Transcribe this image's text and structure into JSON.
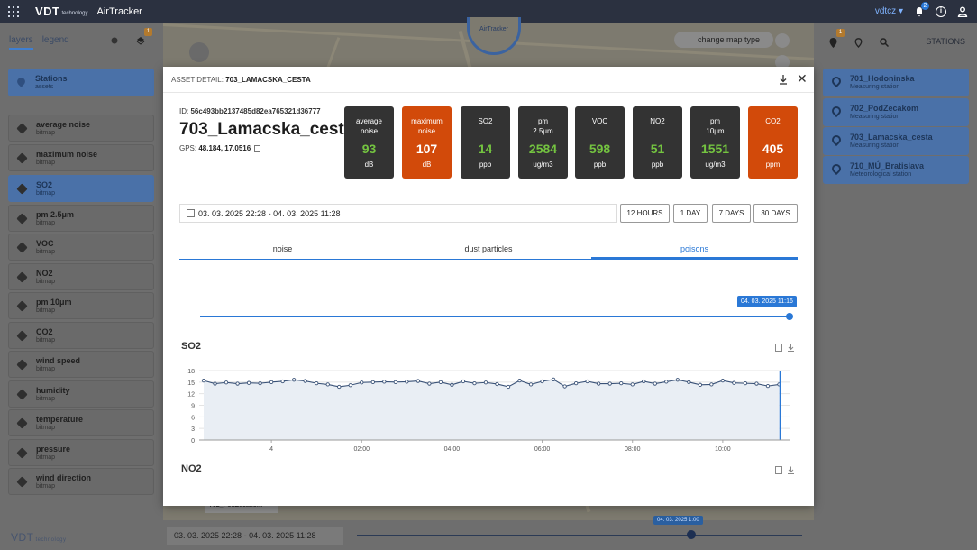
{
  "app": {
    "logo": "VDT",
    "logo_sub": "technology",
    "name": "AirTracker",
    "user": "vdtcz",
    "notifications": "2",
    "info": "i"
  },
  "map": {
    "center_badge": "AirTracker",
    "change_map_type": "change map type",
    "label": "702_PodZecakom"
  },
  "left_panel": {
    "tabs": [
      "layers",
      "legend"
    ],
    "badge": "1",
    "stations": {
      "title": "Stations",
      "subtitle": "assets"
    },
    "layers": [
      {
        "title": "average noise",
        "subtitle": "bitmap"
      },
      {
        "title": "maximum noise",
        "subtitle": "bitmap"
      },
      {
        "title": "SO2",
        "subtitle": "bitmap"
      },
      {
        "title": "pm 2.5μm",
        "subtitle": "bitmap"
      },
      {
        "title": "VOC",
        "subtitle": "bitmap"
      },
      {
        "title": "NO2",
        "subtitle": "bitmap"
      },
      {
        "title": "pm 10μm",
        "subtitle": "bitmap"
      },
      {
        "title": "CO2",
        "subtitle": "bitmap"
      },
      {
        "title": "wind speed",
        "subtitle": "bitmap"
      },
      {
        "title": "humidity",
        "subtitle": "bitmap"
      },
      {
        "title": "temperature",
        "subtitle": "bitmap"
      },
      {
        "title": "pressure",
        "subtitle": "bitmap"
      },
      {
        "title": "wind direction",
        "subtitle": "bitmap"
      }
    ],
    "selected_layer": "SO2"
  },
  "right_panel": {
    "title": "STATIONS",
    "badge": "1",
    "stations": [
      {
        "title": "701_Hodoninska",
        "subtitle": "Measuring station"
      },
      {
        "title": "702_PodZecakom",
        "subtitle": "Measuring station"
      },
      {
        "title": "703_Lamacska_cesta",
        "subtitle": "Measuring station"
      },
      {
        "title": "710_MÚ_Bratislava",
        "subtitle": "Meteorological station"
      }
    ]
  },
  "bottom_bar": {
    "range": "03. 03. 2025 22:28 - 04. 03. 2025 11:28",
    "tip": "04. 03. 2025 1:00"
  },
  "modal": {
    "caption_label": "ASSET DETAIL:",
    "caption_value": "703_LAMACSKA_CESTA",
    "id_label": "ID:",
    "id_value": "56c493bb2137485d82ea765321d36777",
    "name": "703_Lamacska_cesta",
    "gps_label": "GPS:",
    "gps_value": "48.184, 17.0516",
    "tiles": [
      {
        "label": "average noise",
        "value": "93",
        "unit": "dB",
        "status": "normal"
      },
      {
        "label": "maximum noise",
        "value": "107",
        "unit": "dB",
        "status": "warning"
      },
      {
        "label": "SO2",
        "value": "14",
        "unit": "ppb",
        "status": "normal"
      },
      {
        "label": "pm 2.5μm",
        "value": "2584",
        "unit": "ug/m3",
        "status": "normal"
      },
      {
        "label": "VOC",
        "value": "598",
        "unit": "ppb",
        "status": "normal"
      },
      {
        "label": "NO2",
        "value": "51",
        "unit": "ppb",
        "status": "normal"
      },
      {
        "label": "pm 10μm",
        "value": "1551",
        "unit": "ug/m3",
        "status": "normal"
      },
      {
        "label": "CO2",
        "value": "405",
        "unit": "ppm",
        "status": "warning"
      }
    ],
    "date_range": "03. 03. 2025 22:28 - 04. 03. 2025 11:28",
    "range_buttons": [
      "12 HOURS",
      "1 DAY",
      "7 DAYS",
      "30 DAYS"
    ],
    "tabs": [
      "noise",
      "dust particles",
      "poisons"
    ],
    "active_tab": "poisons",
    "slider_tip": "04. 03. 2025 11:16",
    "slider_value": 1.0,
    "chart_titles": [
      "SO2",
      "NO2"
    ]
  },
  "colors": {
    "accent": "#2a78d6",
    "tile_normal": "#333333",
    "tile_warning": "#d24a0a",
    "value_green": "#74c440"
  },
  "chart_data": {
    "type": "line",
    "title": "SO2",
    "x_ticks": [
      "4",
      "02:00",
      "04:00",
      "06:00",
      "08:00",
      "10:00"
    ],
    "y_ticks": [
      "0",
      "3",
      "6",
      "9",
      "12",
      "15",
      "18"
    ],
    "ylim": [
      0,
      18
    ],
    "xlim_hours": [
      -1.6,
      11.5
    ],
    "grid": true,
    "series": [
      {
        "x_hours": [
          -1.5,
          -1.25,
          -1.0,
          -0.75,
          -0.5,
          -0.25,
          0.0,
          0.25,
          0.5,
          0.75,
          1.0,
          1.25,
          1.5,
          1.75,
          2.0,
          2.25,
          2.5,
          2.75,
          3.0,
          3.25,
          3.5,
          3.75,
          4.0,
          4.25,
          4.5,
          4.75,
          5.0,
          5.25,
          5.5,
          5.75,
          6.0,
          6.25,
          6.5,
          6.75,
          7.0,
          7.25,
          7.5,
          7.75,
          8.0,
          8.25,
          8.5,
          8.75,
          9.0,
          9.25,
          9.5,
          9.75,
          10.0,
          10.25,
          10.5,
          10.75,
          11.0,
          11.25
        ],
        "values": [
          15.4,
          14.6,
          14.9,
          14.6,
          14.8,
          14.7,
          15.0,
          15.2,
          15.6,
          15.3,
          14.7,
          14.4,
          13.8,
          14.2,
          14.9,
          15.0,
          15.1,
          15.0,
          15.1,
          15.3,
          14.6,
          15.0,
          14.3,
          15.2,
          14.7,
          14.9,
          14.5,
          13.8,
          15.4,
          14.4,
          15.2,
          15.7,
          13.9,
          14.7,
          15.2,
          14.6,
          14.6,
          14.7,
          14.4,
          15.2,
          14.6,
          15.1,
          15.6,
          15.0,
          14.3,
          14.4,
          15.4,
          14.8,
          14.7,
          14.6,
          14.0,
          14.4
        ]
      }
    ]
  }
}
